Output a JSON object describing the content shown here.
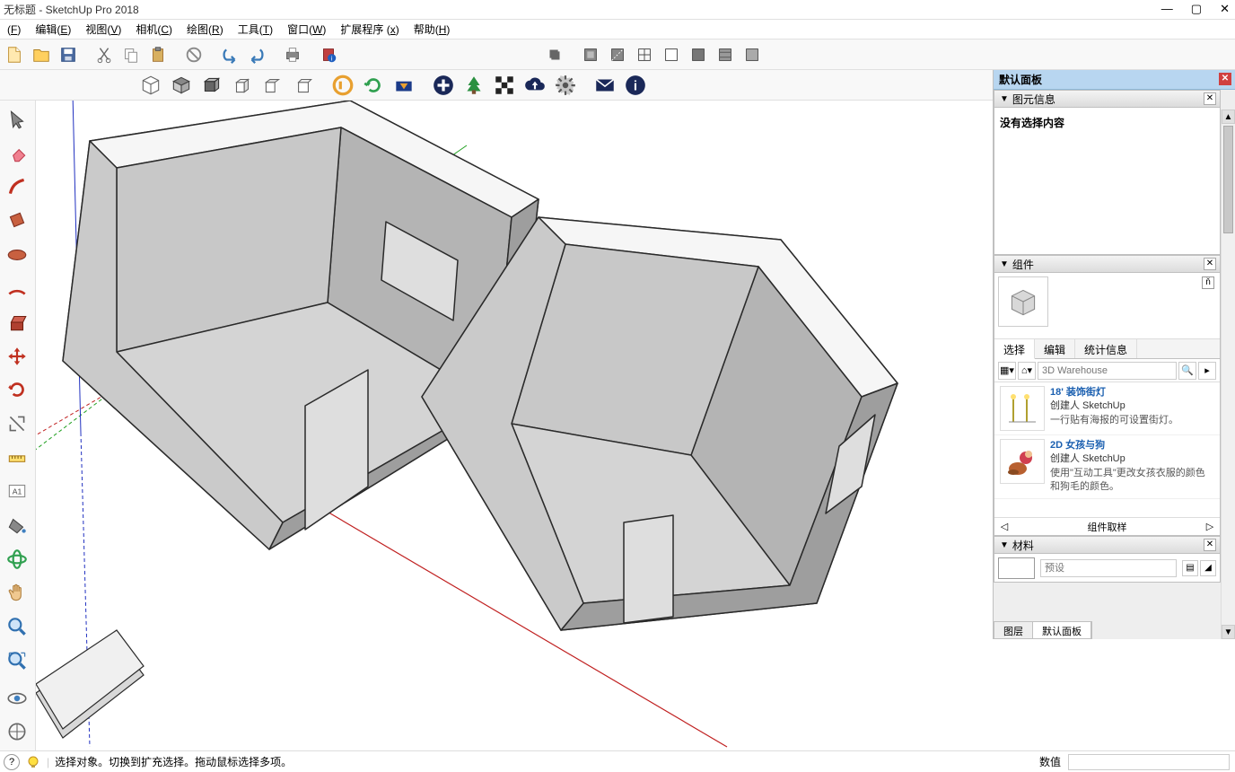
{
  "title": "无标题 - SketchUp Pro 2018",
  "menus": [
    {
      "label": "(F)",
      "u": "F"
    },
    {
      "label": "编辑(E)",
      "u": "E"
    },
    {
      "label": "视图(V)",
      "u": "V"
    },
    {
      "label": "相机(C)",
      "u": "C"
    },
    {
      "label": "绘图(R)",
      "u": "R"
    },
    {
      "label": "工具(T)",
      "u": "T"
    },
    {
      "label": "窗口(W)",
      "u": "W"
    },
    {
      "label": "扩展程序 (x)",
      "u": "x"
    },
    {
      "label": "帮助(H)",
      "u": "H"
    }
  ],
  "panel_title": "默认面板",
  "sections": {
    "entity": {
      "title": "图元信息",
      "msg": "没有选择内容"
    },
    "components": {
      "title": "组件",
      "tabs": [
        "选择",
        "编辑",
        "统计信息"
      ],
      "search_placeholder": "3D Warehouse",
      "nav_label": "组件取样",
      "items": [
        {
          "title": "18' 装饰街灯",
          "author": "创建人 SketchUp",
          "desc": "一行贴有海报的可设置街灯。"
        },
        {
          "title": "2D 女孩与狗",
          "author": "创建人 SketchUp",
          "desc": "使用\"互动工具\"更改女孩衣服的颜色和狗毛的颜色。"
        }
      ]
    },
    "materials": {
      "title": "材料",
      "preset": "预设"
    }
  },
  "panel_tabs": [
    "图层",
    "默认面板"
  ],
  "status": {
    "hint": "选择对象。切换到扩充选择。拖动鼠标选择多项。",
    "value_label": "数值"
  }
}
